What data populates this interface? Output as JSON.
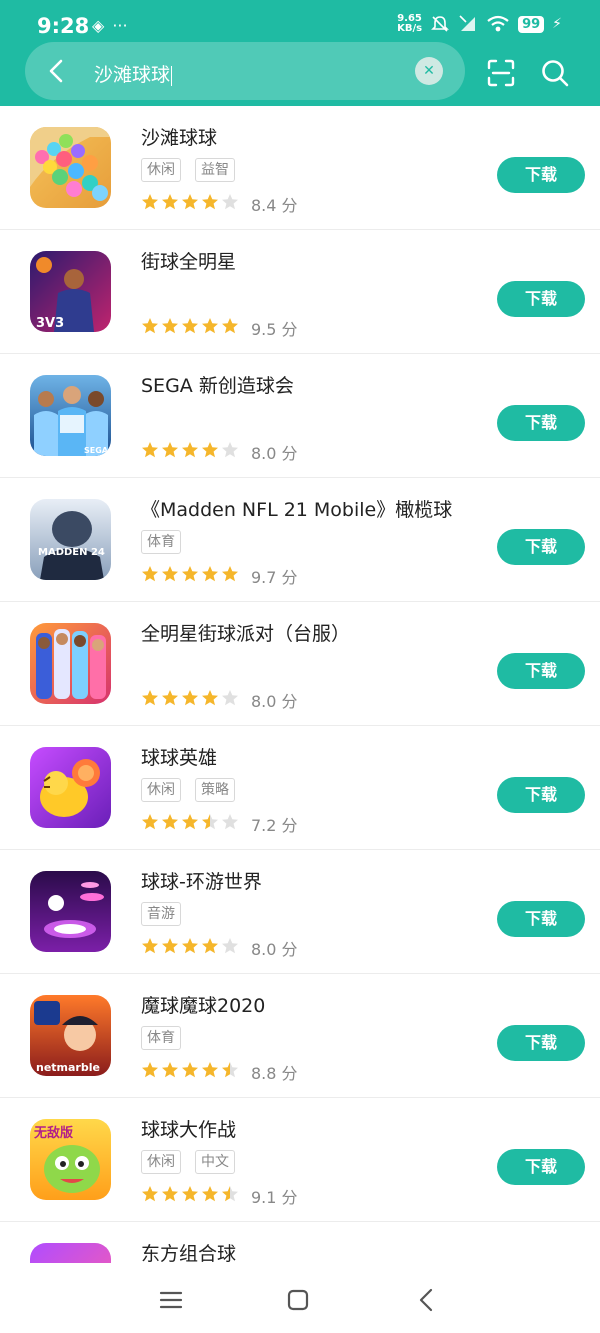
{
  "status": {
    "time": "9:28",
    "left_icons": [
      "◈",
      "···"
    ],
    "speed_top": "9.65",
    "speed_bottom": "KB/s",
    "battery": "99"
  },
  "search": {
    "query": "沙滩球球"
  },
  "colors": {
    "accent": "#1fbba3",
    "star_on": "#f5b62b",
    "star_off": "#e0e0e0"
  },
  "download_label": "下载",
  "score_unit": "分",
  "apps": [
    {
      "title": "沙滩球球",
      "tags": [
        "休闲",
        "益智"
      ],
      "rating": 4,
      "score": "8.4"
    },
    {
      "title": "街球全明星",
      "tags": [],
      "rating": 5,
      "score": "9.5"
    },
    {
      "title": "SEGA 新创造球会",
      "tags": [],
      "rating": 4,
      "score": "8.0"
    },
    {
      "title": "《Madden NFL 21 Mobile》橄榄球",
      "tags": [
        "体育"
      ],
      "rating": 5,
      "score": "9.7"
    },
    {
      "title": "全明星街球派对（台服）",
      "tags": [],
      "rating": 4,
      "score": "8.0"
    },
    {
      "title": "球球英雄",
      "tags": [
        "休闲",
        "策略"
      ],
      "rating": 3.5,
      "score": "7.2"
    },
    {
      "title": "球球-环游世界",
      "tags": [
        "音游"
      ],
      "rating": 4,
      "score": "8.0"
    },
    {
      "title": "魔球魔球2020",
      "tags": [
        "体育"
      ],
      "rating": 4.5,
      "score": "8.8"
    },
    {
      "title": "球球大作战",
      "tags": [
        "休闲",
        "中文"
      ],
      "rating": 4.5,
      "score": "9.1"
    },
    {
      "title": "东方组合球",
      "tags": [],
      "rating": 0,
      "score": ""
    }
  ],
  "icon_texts": {
    "app2": "3V3",
    "app3_logo": "SEGA",
    "app4_logo": "MADDEN 24",
    "app8_logo": "netmarble",
    "app9_logo": "无敌版"
  },
  "icons": {
    "back": "chevron-left-icon",
    "clear": "close-icon",
    "scan": "scan-icon",
    "search": "search-icon",
    "nav_menu": "menu-icon",
    "nav_home": "home-icon",
    "nav_back": "back-icon"
  }
}
